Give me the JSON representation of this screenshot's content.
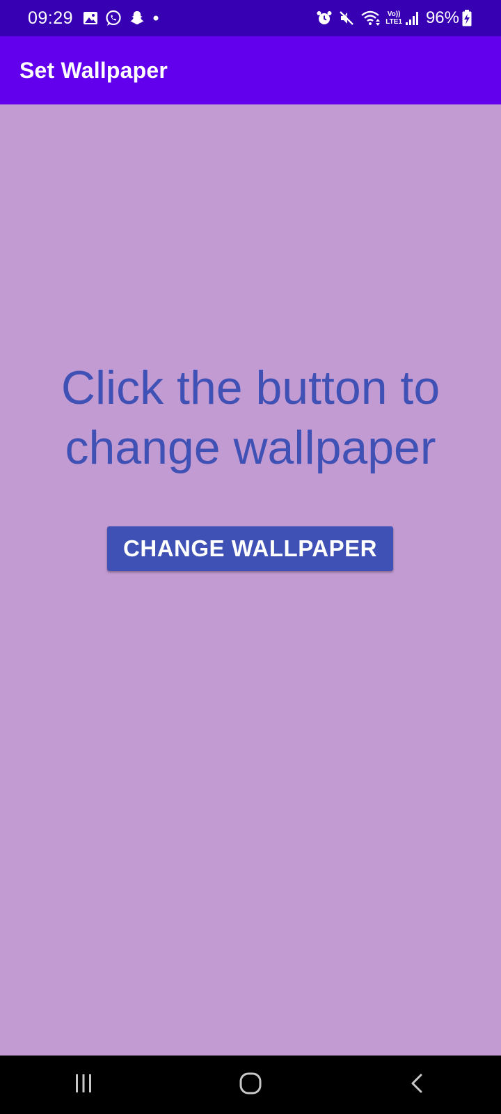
{
  "status_bar": {
    "time": "09:29",
    "battery_percent": "96%",
    "network_top": "Vo))",
    "network_bottom": "LTE1",
    "icons_left": [
      "gallery-icon",
      "whatsapp-icon",
      "snapchat-icon",
      "dot-icon"
    ],
    "icons_right": [
      "alarm-icon",
      "mute-icon",
      "wifi-icon",
      "signal-icon",
      "battery-charging-icon"
    ]
  },
  "app_bar": {
    "title": "Set Wallpaper"
  },
  "main": {
    "prompt_line1": "Click the button to",
    "prompt_line2": "change wallpaper",
    "button_label": "CHANGE WALLPAPER"
  },
  "nav_bar": {
    "buttons": [
      "recents-icon",
      "home-icon",
      "back-icon"
    ]
  },
  "colors": {
    "status_bar": "#3700B3",
    "app_bar": "#6200EE",
    "background": "#C39BD3",
    "accent": "#3F51B5",
    "nav_bar": "#000000"
  }
}
